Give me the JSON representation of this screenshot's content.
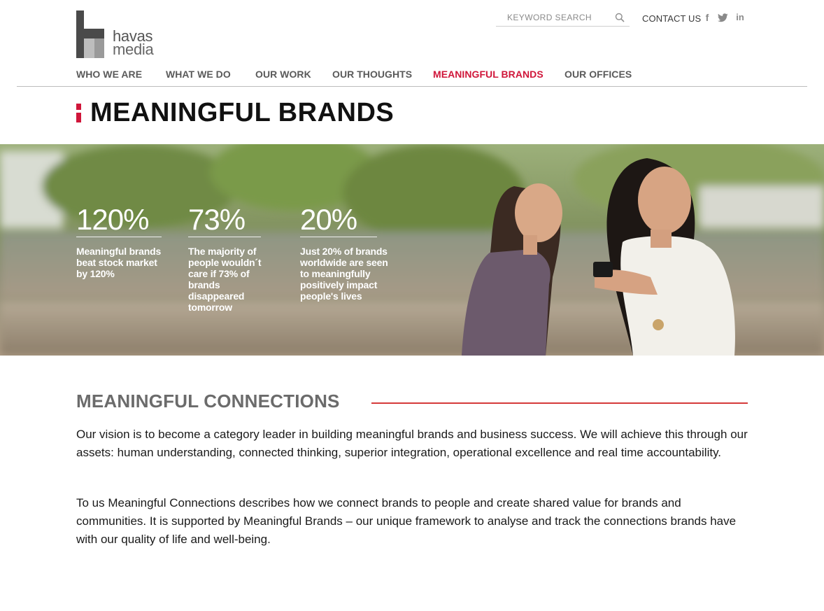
{
  "brand": {
    "logo_line1": "havas",
    "logo_line2": "media"
  },
  "header": {
    "search_placeholder": "KEYWORD SEARCH",
    "contact_label": "CONTACT US",
    "social": [
      "facebook-icon",
      "twitter-icon",
      "linkedin-icon"
    ]
  },
  "nav": {
    "items": [
      {
        "label": "WHO WE ARE",
        "active": false
      },
      {
        "label": "WHAT WE DO",
        "active": false
      },
      {
        "label": "OUR WORK",
        "active": false
      },
      {
        "label": "OUR THOUGHTS",
        "active": false
      },
      {
        "label": "MEANINGFUL BRANDS",
        "active": true
      },
      {
        "label": "OUR OFFICES",
        "active": false
      }
    ]
  },
  "page": {
    "title": "MEANINGFUL BRANDS"
  },
  "hero": {
    "stats": [
      {
        "value": "120%",
        "caption": "Meaningful brands beat stock market by 120%"
      },
      {
        "value": "73%",
        "caption": "The majority of people wouldn´t care if 73% of brands disappeared tomorrow"
      },
      {
        "value": "20%",
        "caption": "Just 20% of brands worldwide are seen to meaningfully positively impact people's lives"
      }
    ]
  },
  "section": {
    "title": "MEANINGFUL CONNECTIONS",
    "paragraph1": "Our vision is to become a category leader in building meaningful brands and business success. We will achieve this through our assets: human understanding, connected thinking, superior integration, operational excellence and real time accountability.",
    "paragraph2": "To us Meaningful Connections describes how we connect brands to people and create shared value for brands and communities. It is supported by Meaningful Brands – our unique framework to analyse and track the connections brands have with our quality of life and well-being."
  },
  "colors": {
    "accent": "#d0163a",
    "nav_text": "#5a5a5a",
    "section_title": "#6b6b6b",
    "section_rule": "#d53a3a"
  }
}
